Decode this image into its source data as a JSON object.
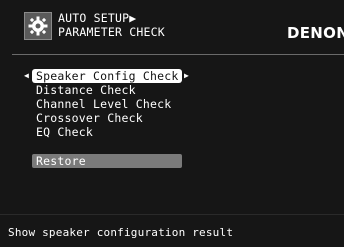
{
  "header": {
    "icon": "gear-icon",
    "title_line1": "AUTO SETUP▶",
    "title_line2": "PARAMETER CHECK",
    "brand": "DENON"
  },
  "menu": {
    "items": [
      {
        "label": "Speaker Config Check",
        "selected": true
      },
      {
        "label": "Distance Check",
        "selected": false
      },
      {
        "label": "Channel Level Check",
        "selected": false
      },
      {
        "label": "Crossover Check",
        "selected": false
      },
      {
        "label": "EQ Check",
        "selected": false
      }
    ],
    "restore_label": "Restore",
    "left_arrow": "◀",
    "right_arrow": "▶"
  },
  "status": {
    "text": "Show speaker configuration result"
  },
  "colors": {
    "background": "#161616",
    "text": "#ffffff",
    "selected_bg": "#ffffff",
    "restore_bg": "#7a7a7a"
  }
}
